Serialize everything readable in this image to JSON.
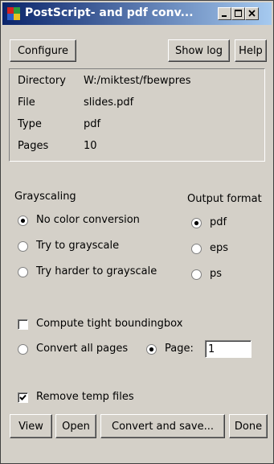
{
  "window": {
    "title": "PostScript- and pdf conv..."
  },
  "toolbar": {
    "configure": "Configure",
    "show_log": "Show log",
    "help": "Help"
  },
  "info": [
    {
      "label": "Directory",
      "value": "W:/miktest/fbewpres"
    },
    {
      "label": "File",
      "value": "slides.pdf"
    },
    {
      "label": "Type",
      "value": "pdf"
    },
    {
      "label": "Pages",
      "value": "10"
    }
  ],
  "grayscaling": {
    "heading": "Grayscaling",
    "options": [
      "No color conversion",
      "Try to grayscale",
      "Try harder to grayscale"
    ],
    "selected": "No color conversion"
  },
  "output_format": {
    "heading": "Output format",
    "options": [
      "pdf",
      "eps",
      "ps"
    ],
    "selected": "pdf"
  },
  "options": {
    "tight_bbox": "Compute tight boundingbox",
    "tight_bbox_checked": false,
    "convert_all": "Convert all pages",
    "page_label": "Page:",
    "page_value": "1",
    "page_selected": true,
    "remove_temp": "Remove temp files",
    "remove_temp_checked": true
  },
  "actions": {
    "view": "View",
    "open": "Open",
    "convert": "Convert and save...",
    "done": "Done"
  }
}
